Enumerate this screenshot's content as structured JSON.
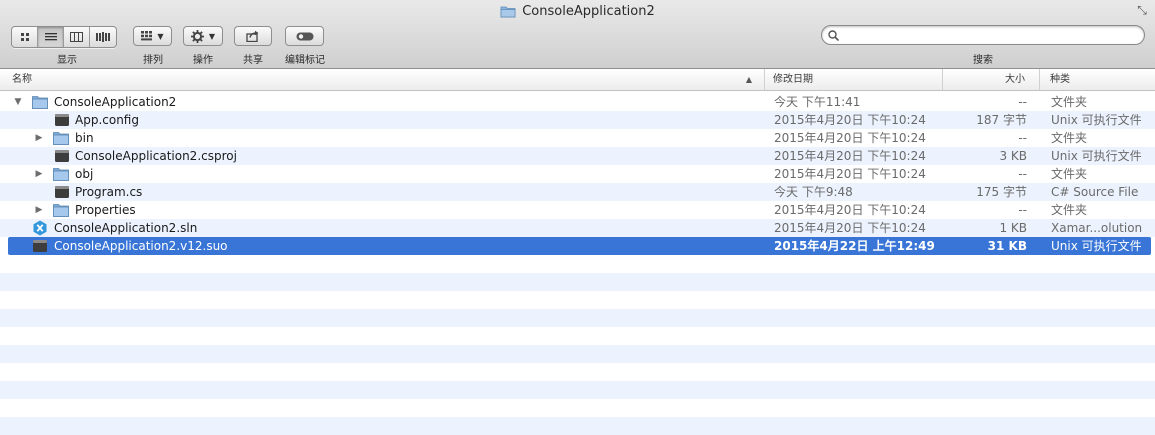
{
  "window": {
    "title": "ConsoleApplication2"
  },
  "toolbar": {
    "view_label": "显示",
    "arrange_label": "排列",
    "action_label": "操作",
    "share_label": "共享",
    "tags_label": "编辑标记",
    "search_label": "搜索",
    "search_value": ""
  },
  "columns": {
    "name": "名称",
    "date": "修改日期",
    "size": "大小",
    "kind": "种类"
  },
  "files": [
    {
      "name": "ConsoleApplication2",
      "date": "今天 下午11:41",
      "size": "--",
      "kind": "文件夹",
      "icon": "folder-icon",
      "disclosure": "expanded",
      "level": 0
    },
    {
      "name": "App.config",
      "date": "2015年4月20日 下午10:24",
      "size": "187 字节",
      "kind": "Unix 可执行文件",
      "icon": "executable-icon",
      "disclosure": "none",
      "level": 1
    },
    {
      "name": "bin",
      "date": "2015年4月20日 下午10:24",
      "size": "--",
      "kind": "文件夹",
      "icon": "folder-icon",
      "disclosure": "collapsed",
      "level": 1
    },
    {
      "name": "ConsoleApplication2.csproj",
      "date": "2015年4月20日 下午10:24",
      "size": "3 KB",
      "kind": "Unix 可执行文件",
      "icon": "executable-icon",
      "disclosure": "none",
      "level": 1
    },
    {
      "name": "obj",
      "date": "2015年4月20日 下午10:24",
      "size": "--",
      "kind": "文件夹",
      "icon": "folder-icon",
      "disclosure": "collapsed",
      "level": 1
    },
    {
      "name": "Program.cs",
      "date": "今天 下午9:48",
      "size": "175 字节",
      "kind": "C# Source File",
      "icon": "executable-icon",
      "disclosure": "none",
      "level": 1
    },
    {
      "name": "Properties",
      "date": "2015年4月20日 下午10:24",
      "size": "--",
      "kind": "文件夹",
      "icon": "folder-icon",
      "disclosure": "collapsed",
      "level": 1
    },
    {
      "name": "ConsoleApplication2.sln",
      "date": "2015年4月20日 下午10:24",
      "size": "1 KB",
      "kind": "Xamar...olution",
      "icon": "xamarin-solution-icon",
      "disclosure": "none",
      "level": 0
    },
    {
      "name": "ConsoleApplication2.v12.suo",
      "date": "2015年4月22日 上午12:49",
      "size": "31 KB",
      "kind": "Unix 可执行文件",
      "icon": "executable-icon",
      "disclosure": "none",
      "level": 0,
      "selected": true
    }
  ],
  "colors": {
    "selection": "#3875d7",
    "alt_row": "#edf3fe",
    "folder": "#8fb6de"
  }
}
